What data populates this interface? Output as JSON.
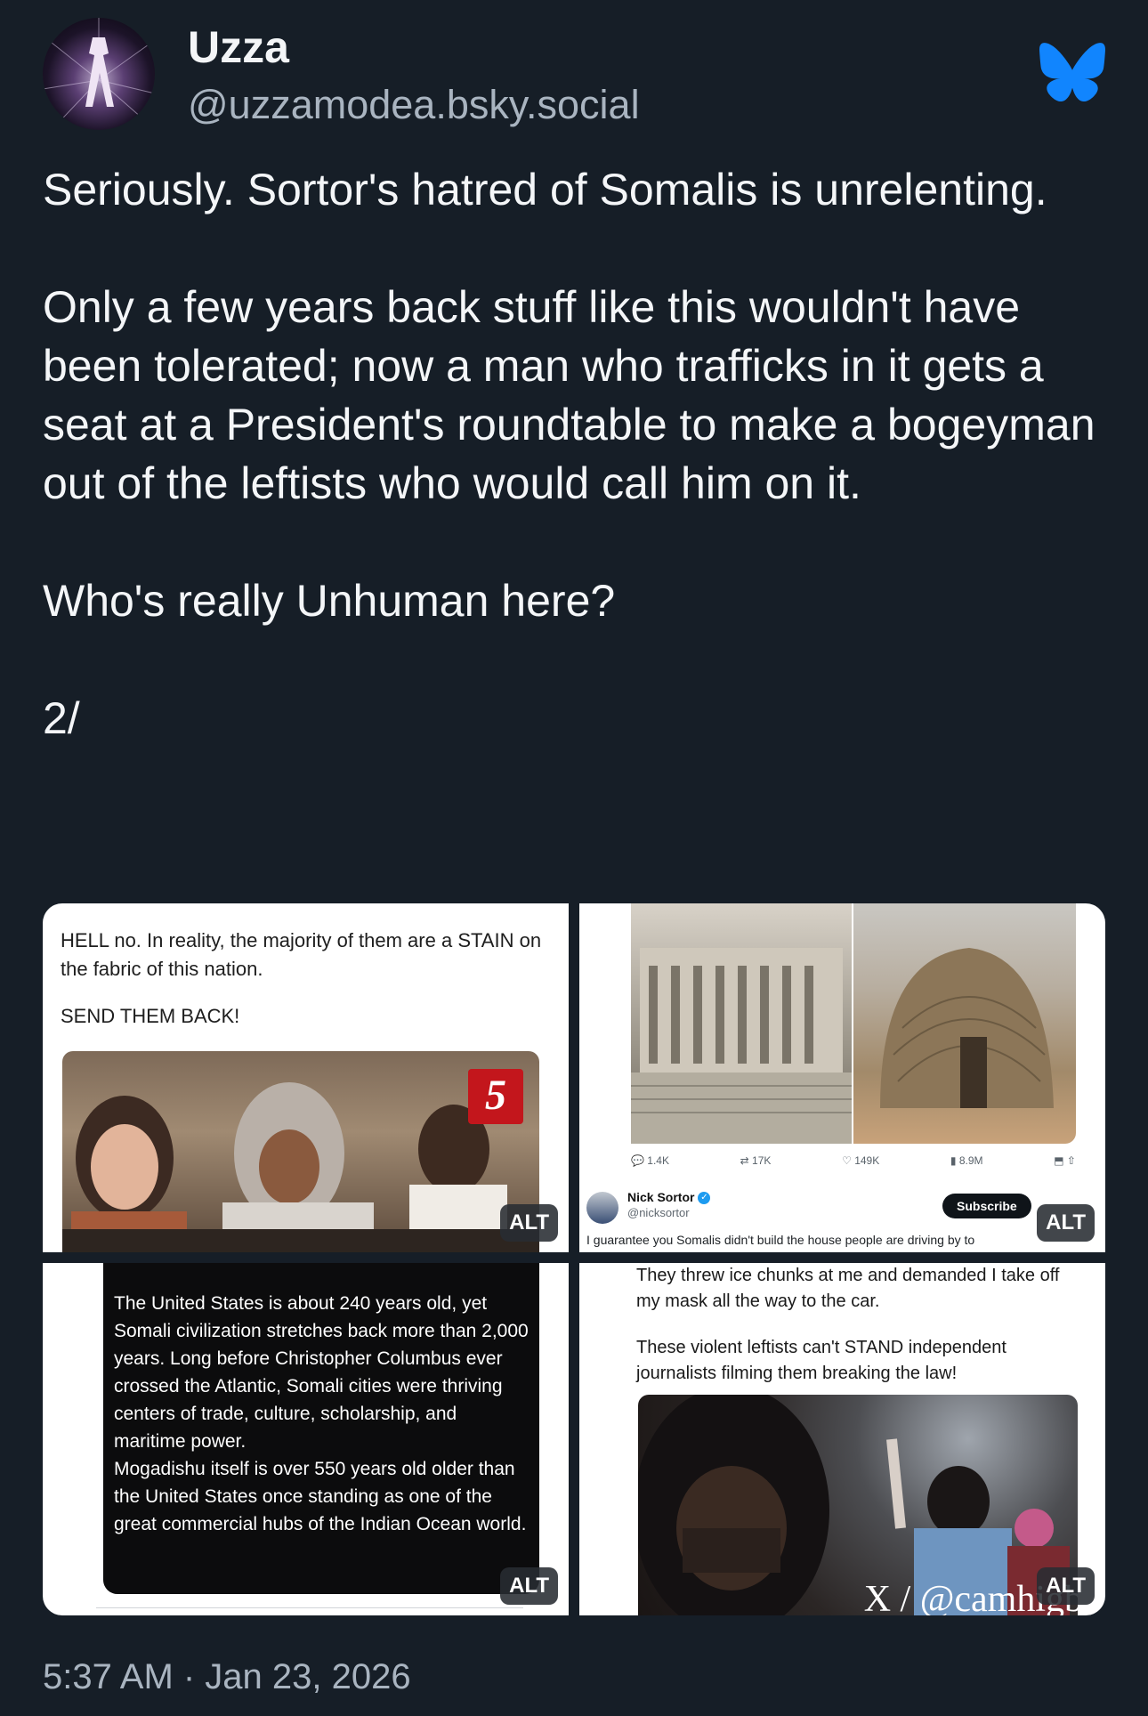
{
  "author": {
    "display_name": "Uzza",
    "handle": "@uzzamodea.bsky.social",
    "avatar_icon": "avatar-image",
    "app_icon": "bluesky-butterfly-icon"
  },
  "post": {
    "paragraphs": [
      "Seriously. Sortor's hatred of Somalis is unrelenting.",
      "Only a few years back stuff like this wouldn't have been tolerated; now a man who trafficks in it gets a seat at a President's roundtable to make a bogeyman out of the leftists who would call him on it.",
      "Who's really Unhuman here?",
      "2/"
    ],
    "timestamp": "5:37 AM · Jan 23, 2026"
  },
  "media": {
    "alt_label": "ALT",
    "tile1": {
      "text": "HELL no. In reality, the majority of them are a STAIN on the fabric of this nation.",
      "text2": "SEND THEM BACK!",
      "logo": "5"
    },
    "tile2": {
      "stats": [
        "1.4K",
        "17K",
        "149K",
        "8.9M"
      ],
      "author_name": "Nick Sortor",
      "author_handle": "@nicksortor",
      "subscribe": "Subscribe",
      "cut_text": "I guarantee you Somalis didn't build the house people are driving by to"
    },
    "tile3": {
      "p1": "The United States is about 240 years old, yet Somali civilization stretches back more than 2,000 years. Long before Christopher Columbus ever crossed the Atlantic, Somali cities were thriving centers of trade, culture, scholarship, and maritime power.",
      "p2": "Mogadishu itself is over 550 years old older than the United States once standing as one of the great commercial hubs of the Indian Ocean world."
    },
    "tile4": {
      "p1": "They threw ice chunks at me and demanded I take off my mask all the way to the car.",
      "p2": "These violent leftists can't STAND  independent journalists filming them breaking the law!",
      "watermark": "X / @camhigby"
    }
  },
  "colors": {
    "background": "#161e27",
    "bluesky_blue": "#1185fe",
    "secondary_text": "#a9b4c0"
  }
}
